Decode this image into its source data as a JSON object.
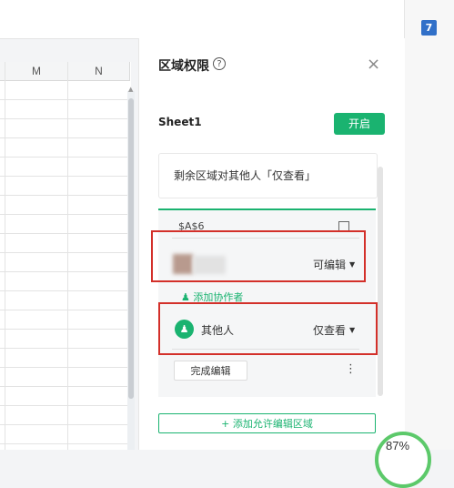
{
  "sheet": {
    "columns": [
      "M",
      "N"
    ]
  },
  "floating": {
    "calendar_day": "7"
  },
  "panel": {
    "title": "区域权限",
    "help_glyph": "?",
    "close_glyph": "×",
    "sheet_name": "Sheet1",
    "enable_button": "开启",
    "remaining_text": "剩余区域对其他人「仅查看」",
    "region_name": "$A$6",
    "collaborator_permission": "可编辑",
    "add_collaborator": "添加协作者",
    "others_label": "其他人",
    "others_permission": "仅查看",
    "done_button": "完成编辑",
    "more_glyph": "⋮",
    "add_region_button": "+ 添加允许编辑区域",
    "accent_color": "#1ab370",
    "highlight_color": "#d3302a"
  },
  "status": {
    "zoom": "87%"
  }
}
